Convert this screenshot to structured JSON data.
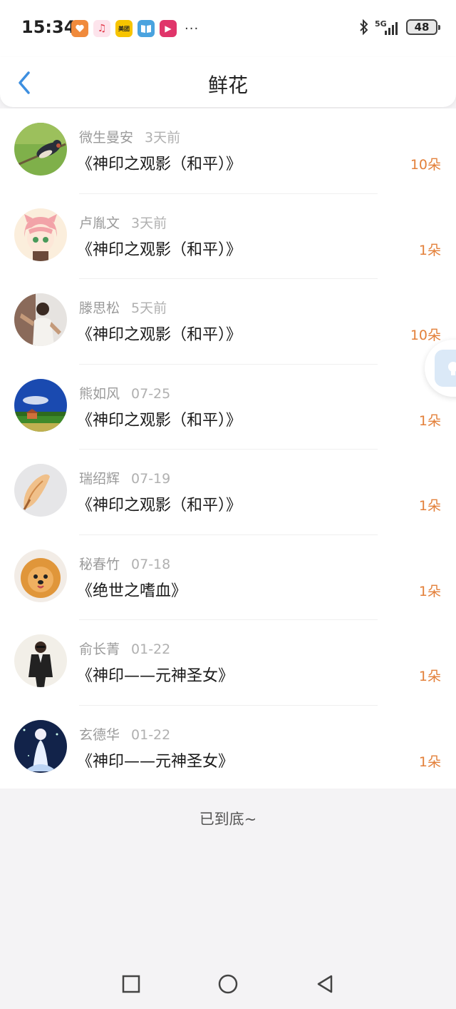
{
  "status_bar": {
    "time": "15:34",
    "app_icons": [
      {
        "icon": "app-icon-orange-heart",
        "color": "#f08a3c",
        "label": ""
      },
      {
        "icon": "music-note-icon",
        "color": "#fde4ec",
        "label": "♫"
      },
      {
        "icon": "meituan-icon",
        "color": "#f7c400",
        "label": "美团"
      },
      {
        "icon": "book-icon",
        "color": "#4aa3df",
        "label": ""
      },
      {
        "icon": "video-play-icon",
        "color": "#e0356a",
        "label": "▶"
      }
    ],
    "more": "···",
    "network": "5G",
    "battery": "48"
  },
  "header": {
    "title": "鲜花"
  },
  "list": {
    "items": [
      {
        "name": "微生曼安",
        "time": "3天前",
        "book": "《神印之观影（和平）》",
        "count": "10朵",
        "avatar": "avatar-bird"
      },
      {
        "name": "卢胤文",
        "time": "3天前",
        "book": "《神印之观影（和平）》",
        "count": "1朵",
        "avatar": "avatar-anime-girl"
      },
      {
        "name": "滕思松",
        "time": "5天前",
        "book": "《神印之观影（和平）》",
        "count": "10朵",
        "avatar": "avatar-man-photo"
      },
      {
        "name": "熊如风",
        "time": "07-25",
        "book": "《神印之观影（和平）》",
        "count": "1朵",
        "avatar": "avatar-landscape"
      },
      {
        "name": "瑞绍辉",
        "time": "07-19",
        "book": "《神印之观影（和平）》",
        "count": "1朵",
        "avatar": "avatar-seashell"
      },
      {
        "name": "秘春竹",
        "time": "07-18",
        "book": "《绝世之嗜血》",
        "count": "1朵",
        "avatar": "avatar-dog"
      },
      {
        "name": "俞长菁",
        "time": "01-22",
        "book": "《神印——元神圣女》",
        "count": "1朵",
        "avatar": "avatar-man-suit"
      },
      {
        "name": "玄德华",
        "time": "01-22",
        "book": "《神印——元神圣女》",
        "count": "1朵",
        "avatar": "avatar-anime-night"
      }
    ]
  },
  "footer": {
    "end_text": "已到底~"
  },
  "colors": {
    "accent": "#e3803a",
    "back_arrow": "#3d8fe0"
  }
}
